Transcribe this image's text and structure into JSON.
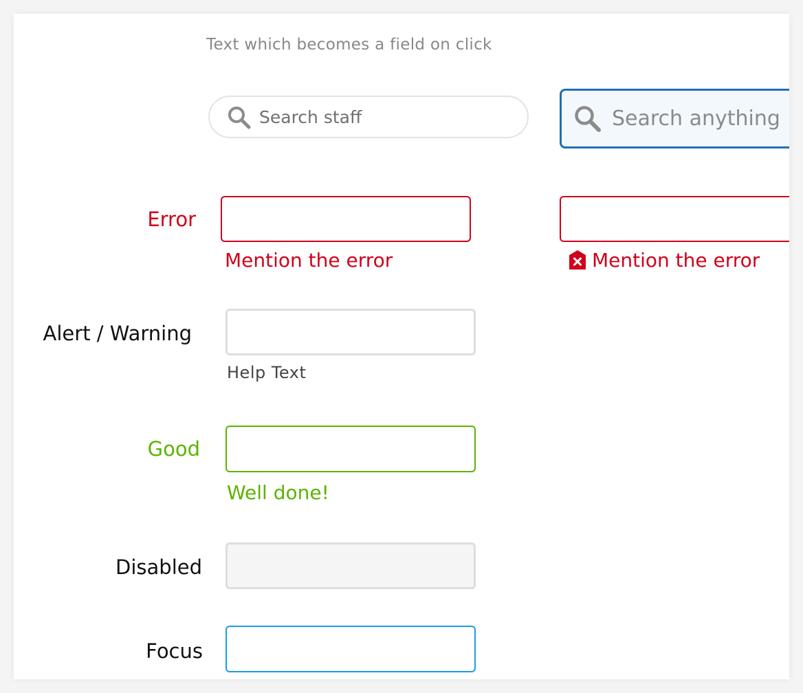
{
  "caption": "Text which becomes a field on click",
  "search_pill": {
    "placeholder": "Search staff",
    "icon": "search-icon"
  },
  "search_box": {
    "placeholder": "Search anything",
    "icon": "search-icon"
  },
  "error": {
    "label": "Error",
    "message": "Mention the error",
    "message_with_icon": "Mention the error",
    "icon": "error-close-icon"
  },
  "alert": {
    "label": "Alert / Warning",
    "help": "Help Text"
  },
  "good": {
    "label": "Good",
    "message": "Well done!"
  },
  "disabled": {
    "label": "Disabled"
  },
  "focus": {
    "label": "Focus"
  },
  "colors": {
    "error": "#d0021b",
    "good": "#5cb300",
    "focus": "#1a9de6",
    "search_active_border": "#1f6fb6",
    "neutral_border": "#dedede"
  }
}
